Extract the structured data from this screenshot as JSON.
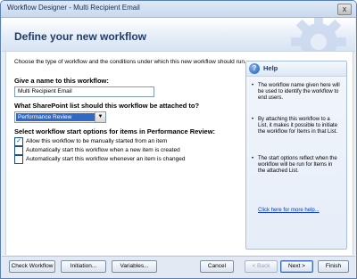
{
  "window": {
    "title": "Workflow Designer - Multi Recipient Email",
    "close_glyph": "x"
  },
  "header": {
    "title": "Define your new workflow",
    "icon": "gear-icon"
  },
  "form": {
    "intro": "Choose the type of workflow and the conditions under which this new workflow should run.",
    "name_label": "Give a name to this workflow:",
    "name_value": "Multi Recipient Email",
    "list_label": "What SharePoint list should this workflow be attached to?",
    "list_value": "Performance Review",
    "dropdown_glyph": "▼",
    "start_label": "Select workflow start options for items in Performance Review:",
    "options": [
      {
        "label": "Allow this workflow to be manually started from an item",
        "checked": true
      },
      {
        "label": "Automatically start this workflow when a new item is created",
        "checked": false
      },
      {
        "label": "Automatically start this workflow whenever an item is changed",
        "checked": false
      }
    ],
    "check_glyph": "✓"
  },
  "help": {
    "icon_glyph": "?",
    "title": "Help",
    "bullet_glyph": "•",
    "bullets": [
      "The workflow name given here will be used to identify the workflow to end users.",
      "By attaching this workflow to a List, it makes it possible to initiate the workflow for Items in that List.",
      "The start options reflect when the workflow will be run for Items in the attached List."
    ],
    "link": "Click here for more help..."
  },
  "footer": {
    "check_workflow": "Check Workflow",
    "initiation": "Initiation...",
    "variables": "Variables...",
    "cancel": "Cancel",
    "back": "< Back",
    "next": "Next >",
    "finish": "Finish"
  }
}
